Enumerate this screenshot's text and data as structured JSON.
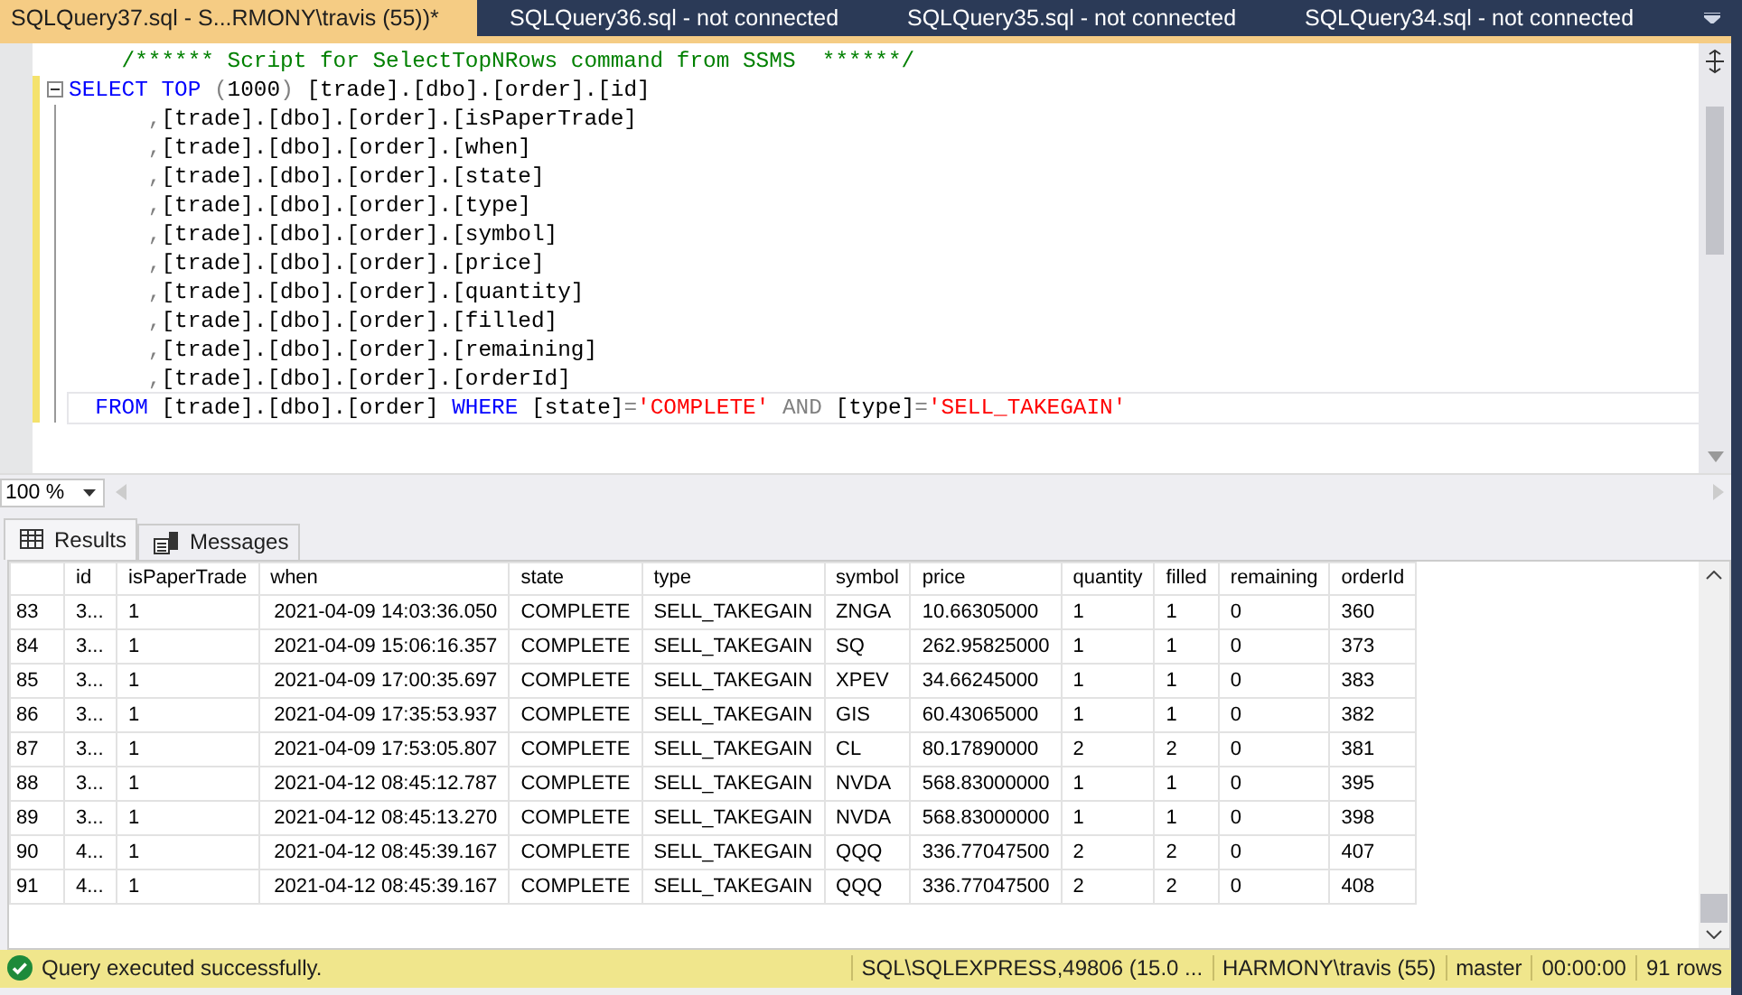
{
  "tabs": [
    {
      "label": "SQLQuery37.sql - S...RMONY\\travis (55))*",
      "selected": true
    },
    {
      "label": "SQLQuery36.sql - not connected",
      "selected": false
    },
    {
      "label": "SQLQuery35.sql - not connected",
      "selected": false
    },
    {
      "label": "SQLQuery34.sql - not connected",
      "selected": false
    }
  ],
  "editor": {
    "lines": [
      [
        {
          "kind": "comment",
          "text": "    /****** Script for SelectTopNRows command from SSMS  ******/"
        }
      ],
      [
        {
          "kind": "keyword",
          "text": "SELECT"
        },
        {
          "kind": "keyword",
          "text": " TOP"
        },
        {
          "kind": "operator",
          "text": " ("
        },
        {
          "kind": "plain",
          "text": "1000"
        },
        {
          "kind": "operator",
          "text": ")"
        },
        {
          "kind": "plain",
          "text": " [trade].[dbo].[order].[id]"
        }
      ],
      [
        {
          "kind": "operator",
          "text": "      ,"
        },
        {
          "kind": "plain",
          "text": "[trade].[dbo].[order].[isPaperTrade]"
        }
      ],
      [
        {
          "kind": "operator",
          "text": "      ,"
        },
        {
          "kind": "plain",
          "text": "[trade].[dbo].[order].[when]"
        }
      ],
      [
        {
          "kind": "operator",
          "text": "      ,"
        },
        {
          "kind": "plain",
          "text": "[trade].[dbo].[order].[state]"
        }
      ],
      [
        {
          "kind": "operator",
          "text": "      ,"
        },
        {
          "kind": "plain",
          "text": "[trade].[dbo].[order].[type]"
        }
      ],
      [
        {
          "kind": "operator",
          "text": "      ,"
        },
        {
          "kind": "plain",
          "text": "[trade].[dbo].[order].[symbol]"
        }
      ],
      [
        {
          "kind": "operator",
          "text": "      ,"
        },
        {
          "kind": "plain",
          "text": "[trade].[dbo].[order].[price]"
        }
      ],
      [
        {
          "kind": "operator",
          "text": "      ,"
        },
        {
          "kind": "plain",
          "text": "[trade].[dbo].[order].[quantity]"
        }
      ],
      [
        {
          "kind": "operator",
          "text": "      ,"
        },
        {
          "kind": "plain",
          "text": "[trade].[dbo].[order].[filled]"
        }
      ],
      [
        {
          "kind": "operator",
          "text": "      ,"
        },
        {
          "kind": "plain",
          "text": "[trade].[dbo].[order].[remaining]"
        }
      ],
      [
        {
          "kind": "operator",
          "text": "      ,"
        },
        {
          "kind": "plain",
          "text": "[trade].[dbo].[order].[orderId]"
        }
      ],
      [
        {
          "kind": "keyword",
          "text": "  FROM"
        },
        {
          "kind": "plain",
          "text": " [trade].[dbo].[order] "
        },
        {
          "kind": "keyword",
          "text": "WHERE"
        },
        {
          "kind": "plain",
          "text": " [state]"
        },
        {
          "kind": "operator",
          "text": "="
        },
        {
          "kind": "string",
          "text": "'COMPLETE'"
        },
        {
          "kind": "operator",
          "text": " AND"
        },
        {
          "kind": "plain",
          "text": " [type]"
        },
        {
          "kind": "operator",
          "text": "="
        },
        {
          "kind": "string",
          "text": "'SELL_TAKEGAIN'"
        }
      ]
    ]
  },
  "zoom": "100 %",
  "result_tabs": [
    {
      "label": "Results",
      "selected": true
    },
    {
      "label": "Messages",
      "selected": false
    }
  ],
  "grid": {
    "columns": [
      "id",
      "isPaperTrade",
      "when",
      "state",
      "type",
      "symbol",
      "price",
      "quantity",
      "filled",
      "remaining",
      "orderId"
    ],
    "rows": [
      {
        "number": "83",
        "cells": [
          "3...",
          "1",
          "2021-04-09 14:03:36.050",
          "COMPLETE",
          "SELL_TAKEGAIN",
          "ZNGA",
          "10.66305000",
          "1",
          "1",
          "0",
          "360"
        ]
      },
      {
        "number": "84",
        "cells": [
          "3...",
          "1",
          "2021-04-09 15:06:16.357",
          "COMPLETE",
          "SELL_TAKEGAIN",
          "SQ",
          "262.95825000",
          "1",
          "1",
          "0",
          "373"
        ]
      },
      {
        "number": "85",
        "cells": [
          "3...",
          "1",
          "2021-04-09 17:00:35.697",
          "COMPLETE",
          "SELL_TAKEGAIN",
          "XPEV",
          "34.66245000",
          "1",
          "1",
          "0",
          "383"
        ]
      },
      {
        "number": "86",
        "cells": [
          "3...",
          "1",
          "2021-04-09 17:35:53.937",
          "COMPLETE",
          "SELL_TAKEGAIN",
          "GIS",
          "60.43065000",
          "1",
          "1",
          "0",
          "382"
        ]
      },
      {
        "number": "87",
        "cells": [
          "3...",
          "1",
          "2021-04-09 17:53:05.807",
          "COMPLETE",
          "SELL_TAKEGAIN",
          "CL",
          "80.17890000",
          "2",
          "2",
          "0",
          "381"
        ]
      },
      {
        "number": "88",
        "cells": [
          "3...",
          "1",
          "2021-04-12 08:45:12.787",
          "COMPLETE",
          "SELL_TAKEGAIN",
          "NVDA",
          "568.83000000",
          "1",
          "1",
          "0",
          "395"
        ]
      },
      {
        "number": "89",
        "cells": [
          "3...",
          "1",
          "2021-04-12 08:45:13.270",
          "COMPLETE",
          "SELL_TAKEGAIN",
          "NVDA",
          "568.83000000",
          "1",
          "1",
          "0",
          "398"
        ]
      },
      {
        "number": "90",
        "cells": [
          "4...",
          "1",
          "2021-04-12 08:45:39.167",
          "COMPLETE",
          "SELL_TAKEGAIN",
          "QQQ",
          "336.77047500",
          "2",
          "2",
          "0",
          "407"
        ]
      },
      {
        "number": "91",
        "cells": [
          "4...",
          "1",
          "2021-04-12 08:45:39.167",
          "COMPLETE",
          "SELL_TAKEGAIN",
          "QQQ",
          "336.77047500",
          "2",
          "2",
          "0",
          "408"
        ]
      }
    ]
  },
  "status_bar": {
    "message": "Query executed successfully.",
    "segments": [
      "SQL\\SQLEXPRESS,49806 (15.0 ...",
      "HARMONY\\travis (55)",
      "master",
      "00:00:00",
      "91 rows"
    ]
  }
}
